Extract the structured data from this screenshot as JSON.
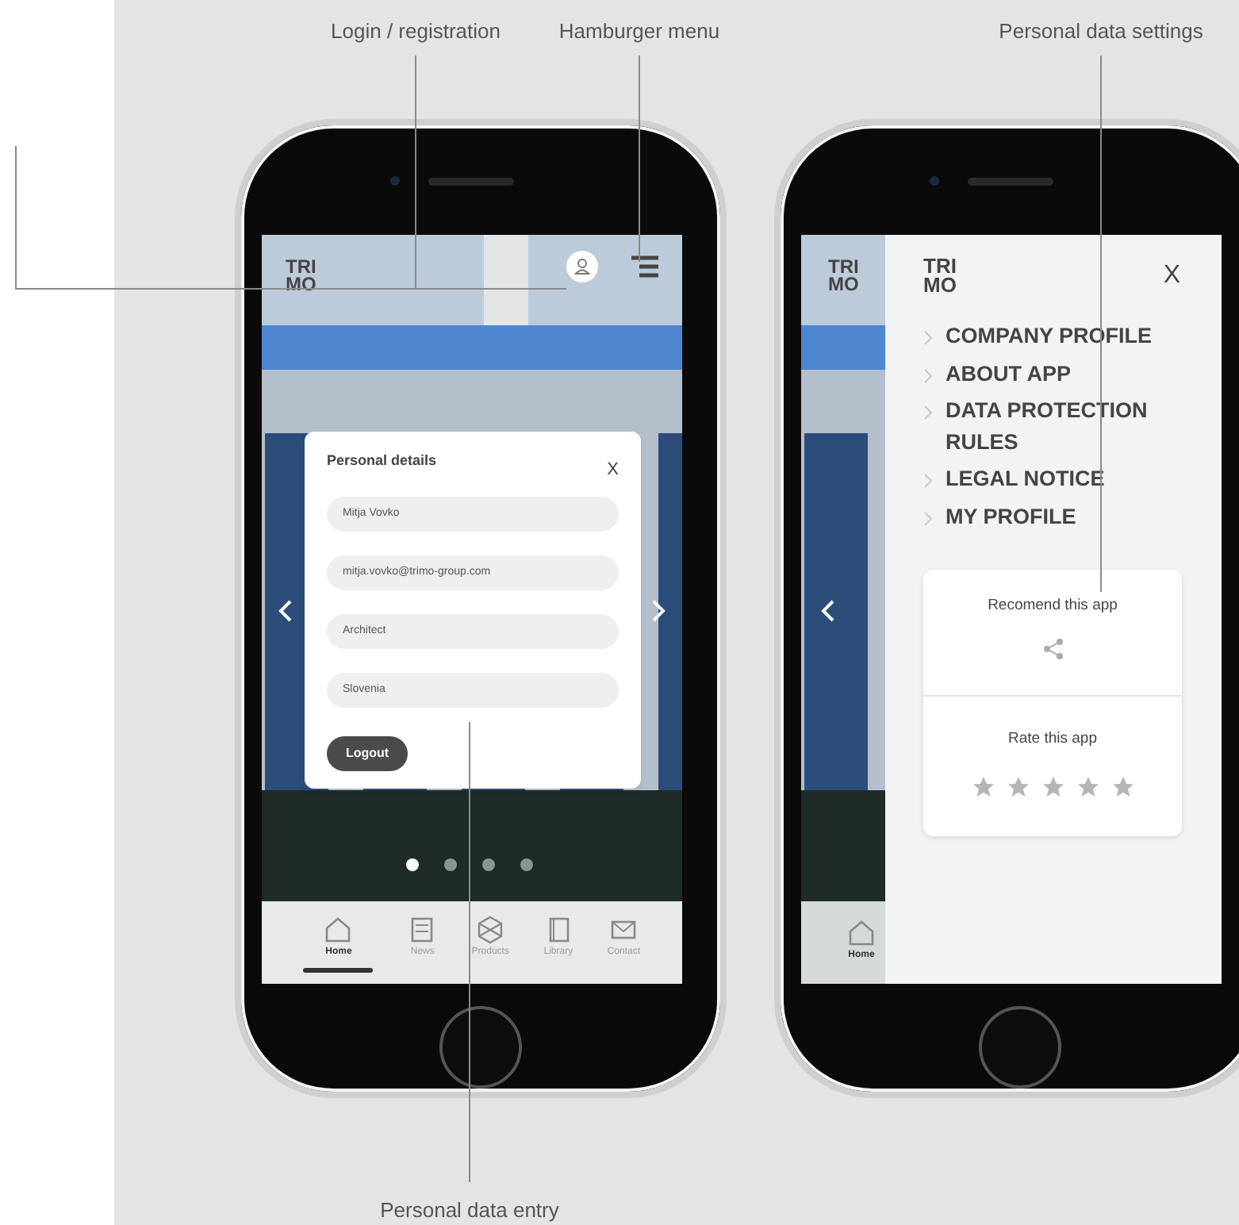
{
  "callouts": [
    {
      "label": "Login / registration"
    },
    {
      "label": "Hamburger menu"
    },
    {
      "label": "Personal data settings"
    },
    {
      "label": "Personal data entry"
    }
  ],
  "phone_1": {
    "logo": "TRI MO",
    "modal": {
      "title": "Personal details",
      "close": "X",
      "fields": [
        {
          "value": "Mitja Vovko"
        },
        {
          "value": "mitja.vovko@trimo-group.com"
        },
        {
          "value": "Architect"
        },
        {
          "value": "Slovenia"
        }
      ],
      "button": "Logout"
    },
    "carousel_dots": [
      {
        "selected": true
      },
      {
        "selected": false
      },
      {
        "selected": false
      },
      {
        "selected": false
      }
    ],
    "nav": [
      {
        "label": "Home",
        "selected": true
      },
      {
        "label": "News",
        "selected": false
      },
      {
        "label": "Products",
        "selected": false
      },
      {
        "label": "Library",
        "selected": false
      },
      {
        "label": "Contact",
        "selected": false
      }
    ]
  },
  "phone_2": {
    "logo": "TRI MO",
    "nav_label": "Home",
    "menu": {
      "logo": "TRI MO",
      "close": "X",
      "items": [
        {
          "label": "COMPANY PROFILE"
        },
        {
          "label": "ABOUT APP"
        },
        {
          "label": "DATA PROTECTION RULES"
        },
        {
          "label": "LEGAL NOTICE"
        },
        {
          "label": "MY PROFILE"
        }
      ],
      "recommend": {
        "title": "Recomend this app"
      },
      "rate": {
        "title": "Rate this app",
        "stars": 0
      }
    }
  }
}
